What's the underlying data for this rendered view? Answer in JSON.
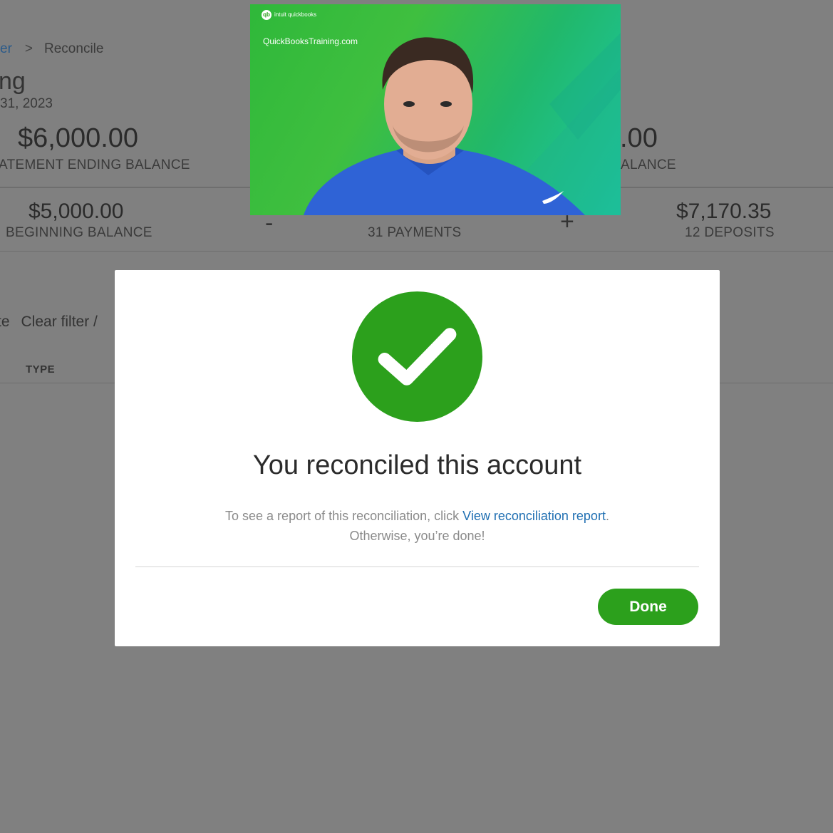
{
  "breadcrumb": {
    "parent_fragment": "er",
    "separator": ">",
    "current": "Reconcile"
  },
  "account": {
    "name_fragment": "ng",
    "date_fragment": "31, 2023"
  },
  "summary_top": {
    "statement_ending_amount": "$6,000.00",
    "statement_ending_label": "ATEMENT ENDING BALANCE",
    "right_amount_fragment": ".00",
    "right_label_fragment": "ALANCE"
  },
  "summary_bottom": {
    "beginning_amount": "$5,000.00",
    "beginning_label": "BEGINNING BALANCE",
    "minus_symbol": "-",
    "payments_label": "31 PAYMENTS",
    "plus_symbol": "+",
    "deposits_amount": "$7,170.35",
    "deposits_label": "12 DEPOSITS"
  },
  "filters": {
    "left_fragment": "te",
    "clear_filter": "Clear filter /"
  },
  "table": {
    "type_header": "TYPE"
  },
  "webcam": {
    "brand_text": "intuit quickbooks",
    "site_text": "QuickBooksTraining.com"
  },
  "modal": {
    "icon": "checkmark-circle-icon",
    "title": "You reconciled this account",
    "body_prefix": "To see a report of this reconciliation, click ",
    "report_link": "View reconciliation report",
    "body_suffix": ".",
    "body_line2": "Otherwise, you’re done!",
    "done_label": "Done"
  },
  "colors": {
    "overlay": "#808080",
    "primary_green": "#2ca01c",
    "link_blue": "#1f6fb2",
    "check_circle": "#2ca01c"
  }
}
